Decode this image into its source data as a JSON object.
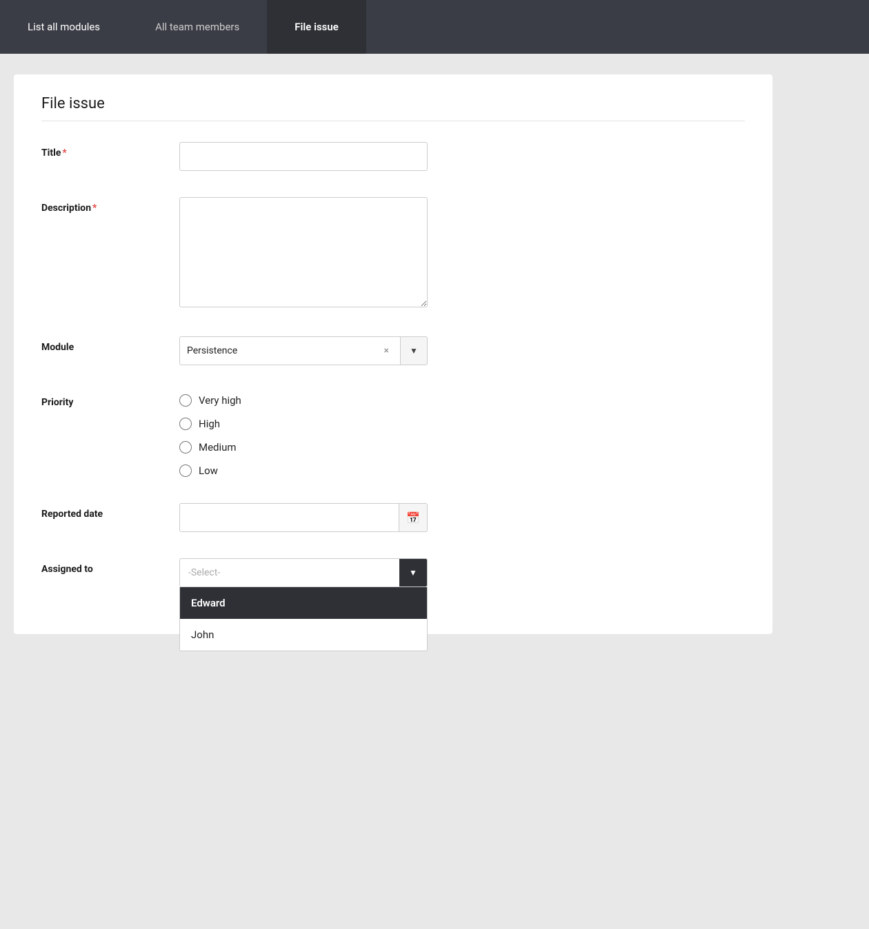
{
  "nav": {
    "tabs": [
      {
        "id": "list-all-modules",
        "label": "List all modules",
        "active": false
      },
      {
        "id": "all-team-members",
        "label": "All team members",
        "active": false
      },
      {
        "id": "file-issue",
        "label": "File issue",
        "active": true
      }
    ]
  },
  "form": {
    "page_title": "File issue",
    "title_label": "Title",
    "title_placeholder": "",
    "description_label": "Description",
    "description_placeholder": "",
    "module_label": "Module",
    "module_value": "Persistence",
    "module_clear_label": "×",
    "priority_label": "Priority",
    "priority_options": [
      {
        "id": "very-high",
        "label": "Very high"
      },
      {
        "id": "high",
        "label": "High"
      },
      {
        "id": "medium",
        "label": "Medium"
      },
      {
        "id": "low",
        "label": "Low"
      }
    ],
    "reported_date_label": "Reported date",
    "reported_date_placeholder": "",
    "assigned_to_label": "Assigned to",
    "assigned_to_placeholder": "-Select-",
    "assigned_dropdown_items": [
      {
        "id": "edward",
        "label": "Edward",
        "highlighted": true
      },
      {
        "id": "john",
        "label": "John",
        "highlighted": false
      }
    ],
    "required_marker": "*"
  }
}
